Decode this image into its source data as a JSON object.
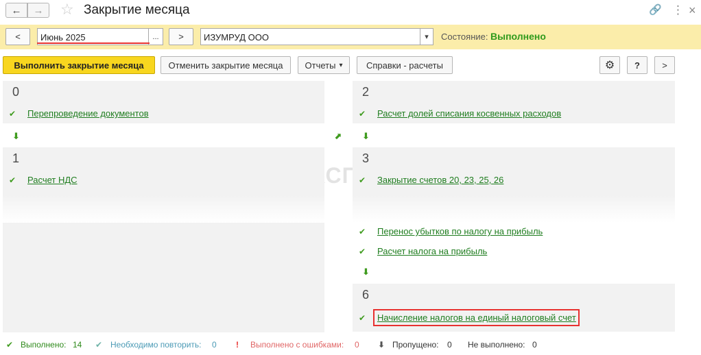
{
  "window": {
    "title": "Закрытие месяца",
    "back_glyph": "←",
    "forward_glyph": "→",
    "star_glyph": "☆",
    "link_glyph": "🔗",
    "more_glyph": "⋮",
    "close_glyph": "×"
  },
  "filters": {
    "prev_label": "<",
    "next_label": ">",
    "period_value": "Июнь 2025",
    "period_picker_label": "...",
    "organization_value": "ИЗУМРУД ООО",
    "organization_dropdown_glyph": "▾",
    "state_label": "Состояние:",
    "state_value": "Выполнено"
  },
  "toolbar": {
    "execute_label": "Выполнить закрытие месяца",
    "cancel_label": "Отменить закрытие месяца",
    "reports_label": "Отчеты",
    "references_label": "Справки - расчеты",
    "help_label": "?",
    "more_label": ">",
    "settings_glyph": "⚙",
    "dropdown_glyph": "▾"
  },
  "stages": {
    "s0": {
      "number": "0",
      "items": [
        "Перепроведение документов"
      ]
    },
    "s1": {
      "number": "1",
      "items": [
        "Расчет НДС"
      ]
    },
    "s2": {
      "number": "2",
      "items": [
        "Расчет долей списания косвенных расходов"
      ]
    },
    "s3": {
      "number": "3",
      "items": [
        "Закрытие счетов 20, 23, 25, 26"
      ]
    },
    "s3_extra": {
      "items": [
        "Перенос убытков по налогу на прибыль",
        "Расчет налога на прибыль"
      ]
    },
    "s6": {
      "number": "6",
      "items": [
        "Начисление налогов на единый налоговый счет"
      ]
    }
  },
  "glyphs": {
    "check": "✔",
    "arrow_down": "⬇",
    "arrow_diag": "⬈",
    "warn": "!",
    "skip": "⬇"
  },
  "watermark": "БУХЭКСПЕРТ",
  "status": {
    "done_label": "Выполнено:",
    "done_count": "14",
    "repeat_label": "Необходимо повторить:",
    "repeat_count": "0",
    "errors_label": "Выполнено с ошибками:",
    "errors_count": "0",
    "skipped_label": "Пропущено:",
    "skipped_count": "0",
    "not_done_label": "Не выполнено:",
    "not_done_count": "0"
  },
  "colors": {
    "accent_yellow": "#f8d61f",
    "panel_yellow": "#fbedaa",
    "success_green": "#2f9a1c",
    "highlight_red": "#e8312f"
  }
}
